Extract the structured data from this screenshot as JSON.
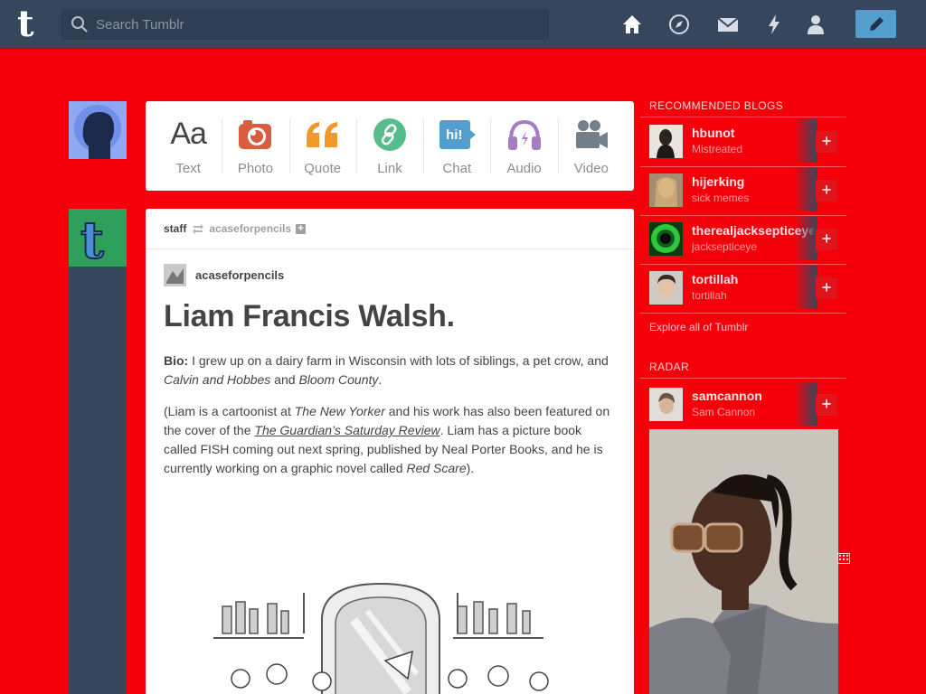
{
  "topbar": {
    "search_placeholder": "Search Tumblr",
    "nav_icons": [
      "home-icon",
      "explore-icon",
      "messages-icon",
      "activity-icon",
      "account-icon"
    ],
    "compose_icon": "pencil-icon"
  },
  "post_types": [
    {
      "label": "Text",
      "icon": "text-icon",
      "glyph": "Aa",
      "color": "#444444"
    },
    {
      "label": "Photo",
      "icon": "camera-icon",
      "color": "#d95e40"
    },
    {
      "label": "Quote",
      "icon": "quote-icon",
      "color": "#f2992e"
    },
    {
      "label": "Link",
      "icon": "link-icon",
      "color": "#56bc8a"
    },
    {
      "label": "Chat",
      "icon": "chat-icon",
      "glyph": "hi!",
      "color": "#529ecc"
    },
    {
      "label": "Audio",
      "icon": "headphones-icon",
      "color": "#a77dc2"
    },
    {
      "label": "Video",
      "icon": "video-camera-icon",
      "color": "#748089"
    }
  ],
  "post": {
    "reblogger": "staff",
    "source": "acaseforpencils",
    "author": "acaseforpencils",
    "title": "Liam Francis Walsh.",
    "bio_label": "Bio:",
    "bio_text": " I grew up on a dairy farm in Wisconsin with lots of siblings, a pet crow, and ",
    "bio_em1": "Calvin and Hobbes",
    "bio_and": " and ",
    "bio_em2": "Bloom County",
    "bio_end": ".",
    "p2_a": "(Liam is a cartoonist at ",
    "p2_em1": "The New Yorker",
    "p2_b": " and his work has also been featured on the cover of the ",
    "p2_link": "The Guardian’s Saturday Review",
    "p2_c": ". Liam has a picture book called FISH coming out next spring, published by Neal Porter Books, and he is currently working on a graphic novel called ",
    "p2_em2": "Red Scare",
    "p2_d": ")."
  },
  "sidebar": {
    "recommended_title": "RECOMMENDED BLOGS",
    "blogs": [
      {
        "name": "hbunot",
        "desc": "Mistreated"
      },
      {
        "name": "hijerking",
        "desc": "sick memes"
      },
      {
        "name": "therealjacksepticeye",
        "desc": "jacksepticeye"
      },
      {
        "name": "tortillah",
        "desc": "tortillah"
      }
    ],
    "explore": "Explore all of Tumblr",
    "radar_title": "RADAR",
    "radar_blog": {
      "name": "samcannon",
      "desc": "Sam Cannon"
    }
  },
  "colors": {
    "background": "#f5000a",
    "navbar": "#36465d",
    "compose": "#529ecc"
  }
}
